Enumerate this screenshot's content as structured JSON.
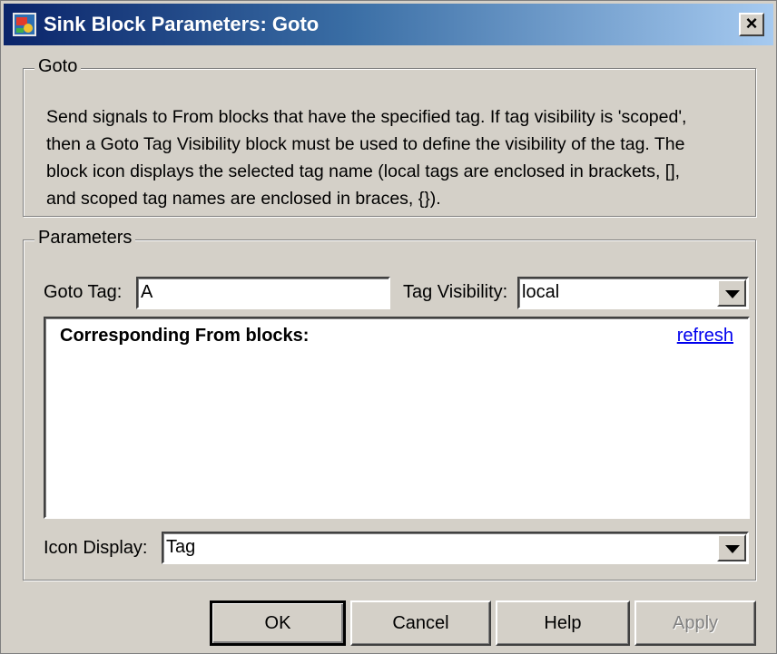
{
  "window": {
    "title": "Sink Block Parameters: Goto",
    "close_label": "×",
    "app_icon": "simulink-block-icon"
  },
  "goto_section": {
    "legend": "Goto",
    "description": "Send signals to From blocks that have the specified tag.  If tag visibility is 'scoped',\nthen a Goto Tag Visibility block must be used to define the visibility of the tag.  The\nblock icon displays the selected tag name (local tags are enclosed in brackets, [],\nand scoped tag names are enclosed in braces, {})."
  },
  "parameters": {
    "legend": "Parameters",
    "goto_tag_label": "Goto Tag:",
    "goto_tag_value": "A",
    "tag_visibility_label": "Tag Visibility:",
    "tag_visibility_value": "local",
    "from_blocks_heading": "Corresponding From blocks:",
    "refresh_link": "refresh",
    "icon_display_label": "Icon Display:",
    "icon_display_value": "Tag"
  },
  "buttons": {
    "ok": "OK",
    "cancel": "Cancel",
    "help": "Help",
    "apply": "Apply"
  },
  "colors": {
    "titlebar_start": "#0a246a",
    "titlebar_end": "#a6caf0",
    "dialog_face": "#d4d0c8",
    "link": "#0000ee"
  }
}
